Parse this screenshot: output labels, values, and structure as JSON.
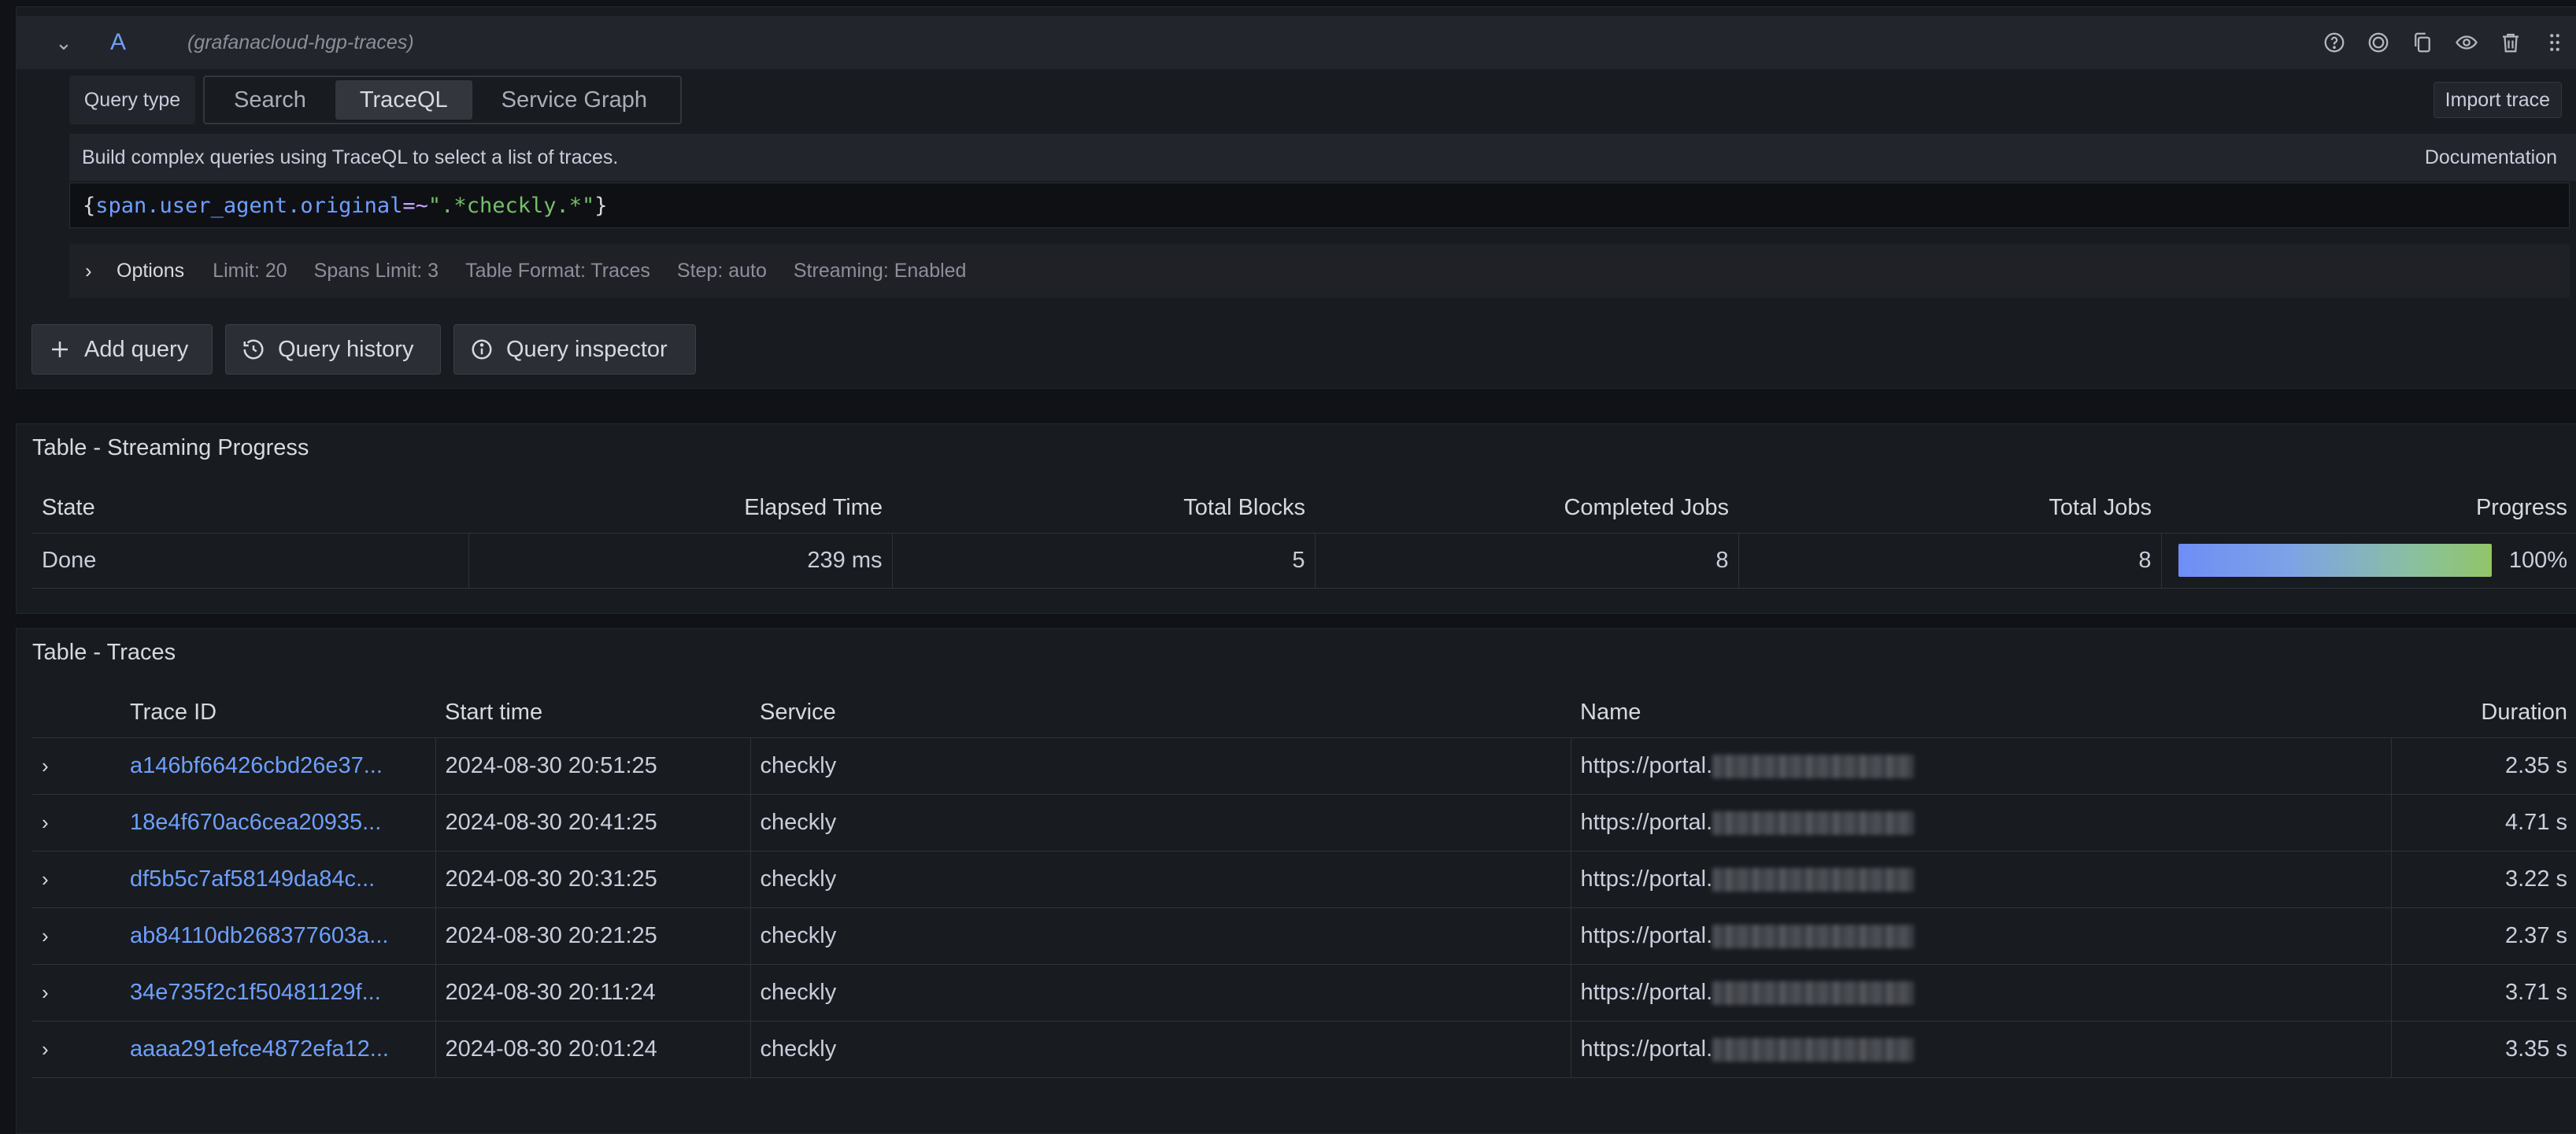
{
  "query": {
    "letter": "A",
    "datasource": "(grafanacloud-hgp-traces)",
    "query_type_label": "Query type",
    "tabs": [
      {
        "label": "Search",
        "active": false
      },
      {
        "label": "TraceQL",
        "active": true
      },
      {
        "label": "Service Graph",
        "active": false
      }
    ],
    "import_trace_label": "Import trace",
    "helper_text": "Build complex queries using TraceQL to select a list of traces.",
    "documentation_label": "Documentation",
    "code": {
      "open_brace": "{",
      "attribute": "span.user_agent.original",
      "operator": "=~",
      "value": "\".*checkly.*\"",
      "close_brace": "}"
    },
    "options": {
      "title": "Options",
      "limit": "Limit: 20",
      "spans_limit": "Spans Limit: 3",
      "table_format": "Table Format: Traces",
      "step": "Step: auto",
      "streaming": "Streaming: Enabled"
    },
    "icons": [
      "help-icon",
      "target-icon",
      "duplicate-icon",
      "eye-icon",
      "trash-icon",
      "drag-handle-icon"
    ]
  },
  "actions": {
    "add_query": "Add query",
    "query_history": "Query history",
    "query_inspector": "Query inspector"
  },
  "streaming_panel": {
    "title": "Table - Streaming Progress",
    "columns": [
      "State",
      "Elapsed Time",
      "Total Blocks",
      "Completed Jobs",
      "Total Jobs",
      "Progress"
    ],
    "row": {
      "state": "Done",
      "elapsed": "239 ms",
      "total_blocks": "5",
      "completed_jobs": "8",
      "total_jobs": "8",
      "progress_pct": 100,
      "progress_label": "100%"
    }
  },
  "traces_panel": {
    "title": "Table - Traces",
    "columns": [
      "Trace ID",
      "Start time",
      "Service",
      "Name",
      "Duration"
    ],
    "rows": [
      {
        "trace_id": "a146bf66426cbd26e37...",
        "start": "2024-08-30 20:51:25",
        "service": "checkly",
        "name": "https://portal.",
        "duration": "2.35 s"
      },
      {
        "trace_id": "18e4f670ac6cea20935...",
        "start": "2024-08-30 20:41:25",
        "service": "checkly",
        "name": "https://portal.",
        "duration": "4.71 s"
      },
      {
        "trace_id": "df5b5c7af58149da84c...",
        "start": "2024-08-30 20:31:25",
        "service": "checkly",
        "name": "https://portal.",
        "duration": "3.22 s"
      },
      {
        "trace_id": "ab84110db268377603a...",
        "start": "2024-08-30 20:21:25",
        "service": "checkly",
        "name": "https://portal.",
        "duration": "2.37 s"
      },
      {
        "trace_id": "34e735f2c1f50481129f...",
        "start": "2024-08-30 20:11:24",
        "service": "checkly",
        "name": "https://portal.",
        "duration": "3.71 s"
      },
      {
        "trace_id": "aaaa291efce4872efa12...",
        "start": "2024-08-30 20:01:24",
        "service": "checkly",
        "name": "https://portal.",
        "duration": "3.35 s"
      }
    ]
  },
  "colors": {
    "background": "#111217",
    "panel": "#181b1f",
    "link": "#6e9fff",
    "progress_start": "#6e8ef5",
    "progress_end": "#92c46a"
  }
}
